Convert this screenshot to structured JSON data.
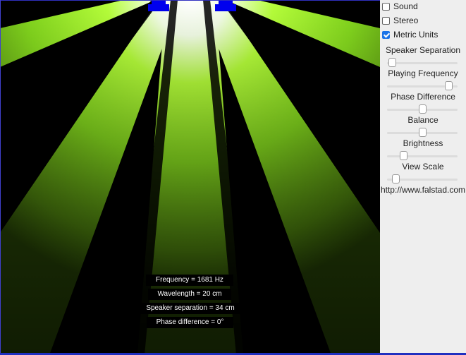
{
  "readouts": {
    "frequency": "Frequency = 1681 Hz",
    "wavelength": "Wavelength = 20 cm",
    "separation": "Speaker separation = 34 cm",
    "phase": "Phase difference = 0°"
  },
  "panel": {
    "checkboxes": [
      {
        "label": "Sound",
        "checked": false
      },
      {
        "label": "Stereo",
        "checked": false
      },
      {
        "label": "Metric Units",
        "checked": true
      }
    ],
    "sliders": [
      {
        "label": "Speaker Separation",
        "value": 0.02
      },
      {
        "label": "Playing Frequency",
        "value": 0.92
      },
      {
        "label": "Phase Difference",
        "value": 0.5
      },
      {
        "label": "Balance",
        "value": 0.5
      },
      {
        "label": "Brightness",
        "value": 0.2
      },
      {
        "label": "View Scale",
        "value": 0.08
      }
    ],
    "url": "http://www.falstad.com"
  },
  "colors": {
    "wave": "#9ef52a",
    "speaker": "#0000ee",
    "panel_bg": "#eeeeee"
  }
}
